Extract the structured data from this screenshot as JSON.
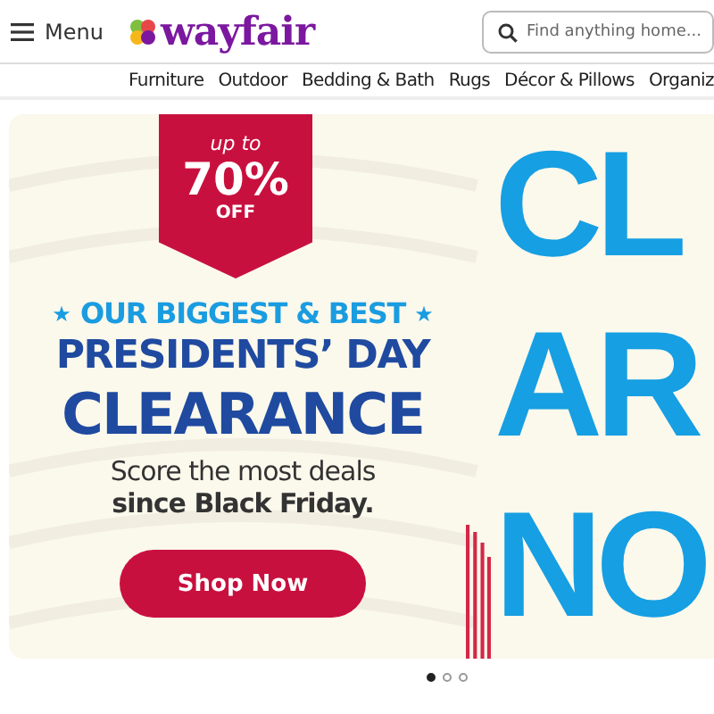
{
  "header": {
    "menu_label": "Menu",
    "logo": "wayfair",
    "search": {
      "placeholder": "Find anything home..."
    }
  },
  "nav": [
    "Furniture",
    "Outdoor",
    "Bedding & Bath",
    "Rugs",
    "Décor & Pillows",
    "Organiz"
  ],
  "hero": {
    "badge": {
      "top": "up to",
      "amount": "70%",
      "bottom": "OFF"
    },
    "eyebrow_star": "★",
    "eyebrow": "OUR BIGGEST & BEST",
    "title_lines": [
      "PRESIDENTS’ DAY",
      "CLEARANCE"
    ],
    "subtitle": "Score the most deals",
    "subtitle_bold": "since Black Friday.",
    "button": "Shop Now",
    "big_letters": [
      "CL",
      "AR",
      "NO"
    ]
  },
  "carousel_dots": [
    {
      "selected": true
    },
    {
      "selected": false
    },
    {
      "selected": false
    }
  ]
}
